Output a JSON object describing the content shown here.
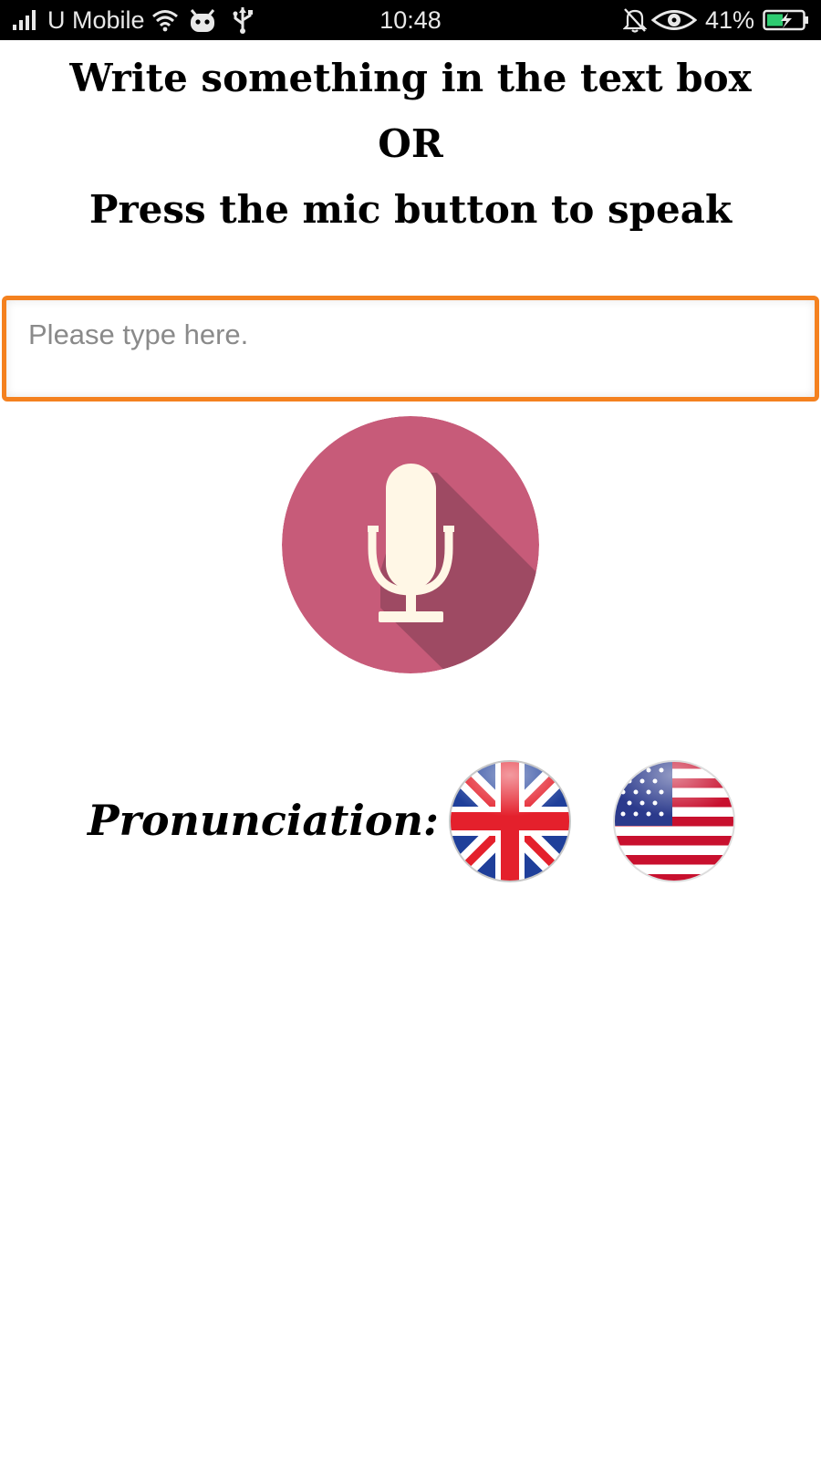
{
  "status_bar": {
    "carrier": "U Mobile",
    "time": "10:48",
    "battery_percent": "41%",
    "icons": [
      "signal-icon",
      "wifi-icon",
      "robot-icon",
      "usb-icon",
      "mute-icon",
      "eye-icon",
      "battery-icon"
    ]
  },
  "instructions": {
    "line1": "Write something in the text box",
    "line2": "OR",
    "line3": "Press the mic button to speak"
  },
  "text_input": {
    "value": "",
    "placeholder": "Please type here."
  },
  "mic": {
    "icon": "microphone-icon",
    "color": "#c75b79",
    "shadow_color": "#9e4a63",
    "glyph_color": "#fff7e6"
  },
  "pronunciation": {
    "label": "Pronunciation:",
    "options": [
      {
        "icon": "uk-flag-icon"
      },
      {
        "icon": "us-flag-icon"
      }
    ]
  },
  "colors": {
    "input_border": "#f4811f",
    "text": "#000000"
  }
}
